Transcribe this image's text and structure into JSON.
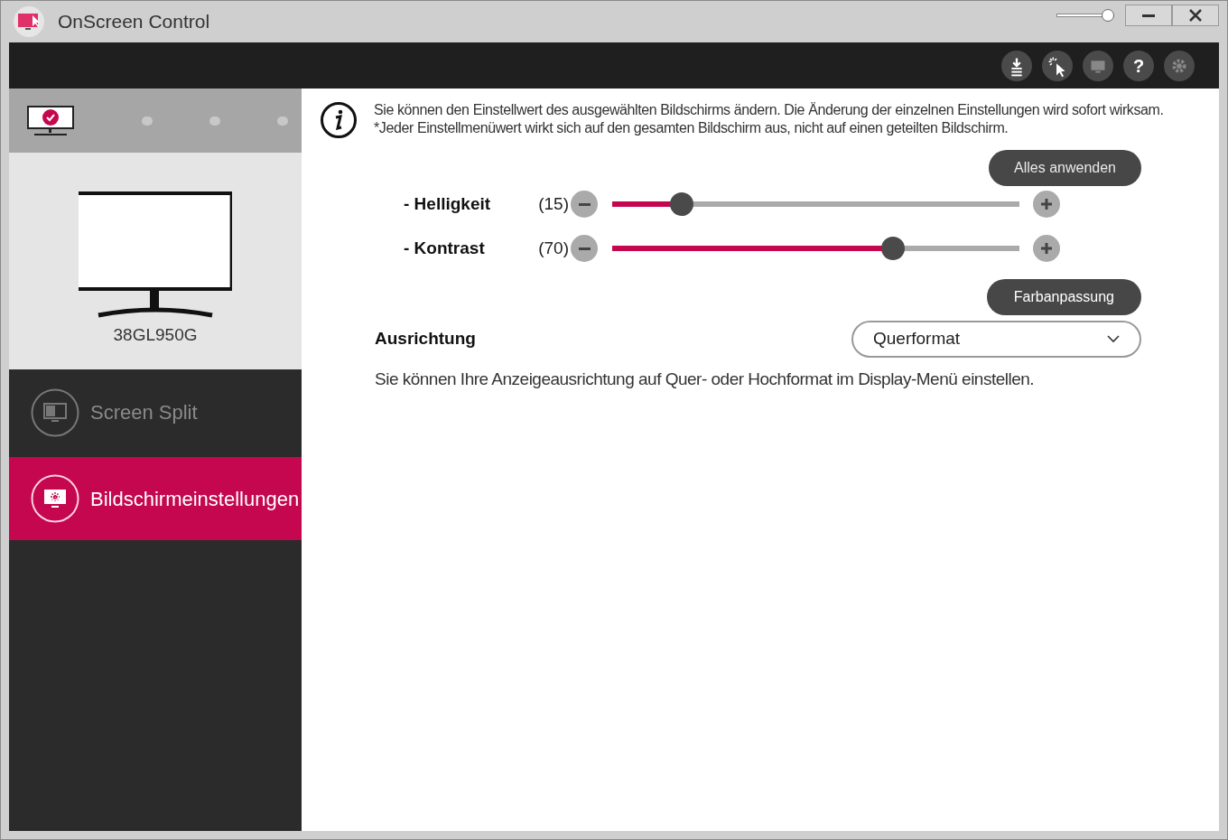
{
  "window": {
    "title": "OnScreen Control",
    "opacity_slider": {
      "level": 1.0
    }
  },
  "toolbar": {
    "buttons": [
      {
        "kind": "download"
      },
      {
        "kind": "cursor"
      },
      {
        "kind": "screen"
      },
      {
        "kind": "help",
        "label": "?"
      },
      {
        "kind": "gear"
      }
    ]
  },
  "monitor_selector": {
    "slots": [
      {
        "kind": "monitor",
        "selected": true
      },
      {
        "kind": "dot",
        "selected": false
      },
      {
        "kind": "dot",
        "selected": false
      },
      {
        "kind": "dot",
        "selected": false
      }
    ]
  },
  "monitor": {
    "model": "38GL950G"
  },
  "sidebar": {
    "items": [
      {
        "label": "Screen Split",
        "kind": "split",
        "selected": false
      },
      {
        "label": "Bildschirmeinstellungen",
        "kind": "settings",
        "selected": true
      }
    ]
  },
  "info": {
    "lines": [
      "Sie können den Einstellwert des ausgewählten Bildschirms ändern. Die Änderung der einzelnen Einstellungen wird sofort wirksam.",
      "*Jeder Einstellmenüwert wirkt sich auf den gesamten Bildschirm aus, nicht auf einen geteilten Bildschirm."
    ]
  },
  "apply_all_button": "Alles anwenden",
  "sliders": [
    {
      "label": "- Helligkeit",
      "reading": "(15)",
      "level": 0.17
    },
    {
      "label": "- Kontrast",
      "reading": "(70)",
      "level": 0.69
    }
  ],
  "color_button": "Farbanpassung",
  "orientation": {
    "title": "Ausrichtung",
    "value": "Querformat",
    "description": "Sie können Ihre Anzeigeausrichtung auf Quer- oder Hochformat im Display-Menü einstellen."
  }
}
